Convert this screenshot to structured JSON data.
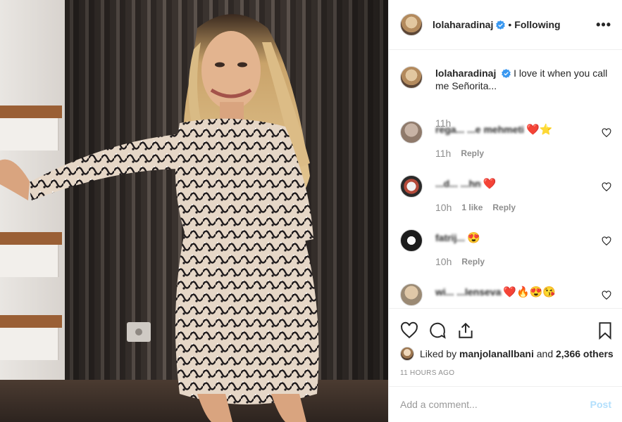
{
  "post": {
    "username": "lolaharadinaj",
    "follow_status": "Following",
    "separator": "•",
    "more_label": "•••",
    "caption": "I love it when you call me Señorita...",
    "caption_time": "11h"
  },
  "comments": [
    {
      "user": "rega... ...e mehmeti",
      "emoji": "❤️⭐",
      "time": "11h",
      "likes": "",
      "reply": "Reply"
    },
    {
      "user": "...d... ...hn",
      "emoji": "❤️",
      "time": "10h",
      "likes": "1 like",
      "reply": "Reply"
    },
    {
      "user": "fatrij...",
      "emoji": "😍",
      "time": "10h",
      "likes": "",
      "reply": "Reply"
    },
    {
      "user": "wi... ...lenseva",
      "emoji": "❤️🔥😍😘",
      "time": "",
      "likes": "",
      "reply": ""
    }
  ],
  "likes": {
    "prefix": "Liked by",
    "user": "manjolanallbani",
    "conj": "and",
    "others": "2,366 others"
  },
  "timestamp": "11 HOURS AGO",
  "add_comment": {
    "placeholder": "Add a comment...",
    "post_label": "Post"
  },
  "icons": {
    "like": "heart-outline-icon",
    "comment": "speech-bubble-icon",
    "share": "share-icon",
    "save": "bookmark-icon",
    "verified": "verified-badge-icon",
    "comment_like": "small-heart-icon"
  },
  "colors": {
    "text": "#262626",
    "secondary": "#8e8e8e",
    "verified": "#3897f0",
    "post_disabled": "#b2dffc",
    "border": "#efefef"
  }
}
